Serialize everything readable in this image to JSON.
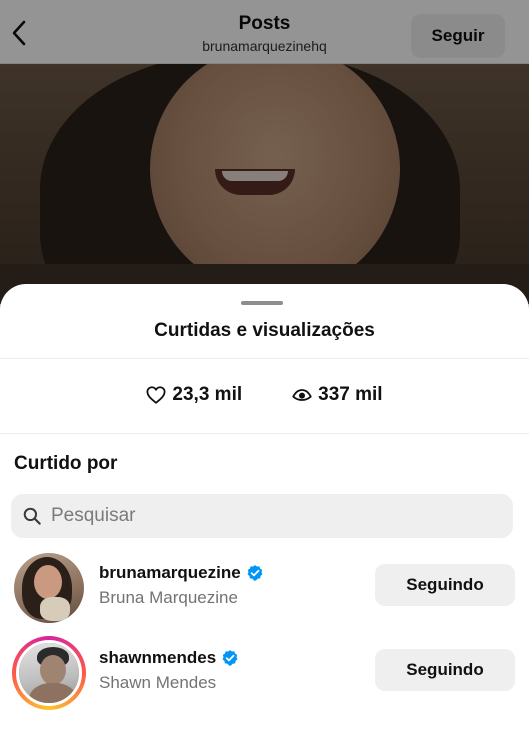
{
  "header": {
    "title": "Posts",
    "username": "brunamarquezinehq",
    "follow_label": "Seguir"
  },
  "sheet": {
    "title": "Curtidas e visualizações",
    "likes_count": "23,3 mil",
    "views_count": "337 mil",
    "liked_by_label": "Curtido por",
    "search_placeholder": "Pesquisar"
  },
  "users": [
    {
      "username": "brunamarquezine",
      "full_name": "Bruna Marquezine",
      "verified": true,
      "has_story": false,
      "button_label": "Seguindo"
    },
    {
      "username": "shawnmendes",
      "full_name": "Shawn Mendes",
      "verified": true,
      "has_story": true,
      "button_label": "Seguindo"
    }
  ],
  "colors": {
    "verified_badge": "#0095f6",
    "button_bg": "#efefef",
    "secondary_text": "#737373"
  },
  "icons": {
    "back": "chevron-left-icon",
    "likes": "heart-icon",
    "views": "eye-icon",
    "search": "search-icon",
    "verified": "verified-badge-icon"
  }
}
